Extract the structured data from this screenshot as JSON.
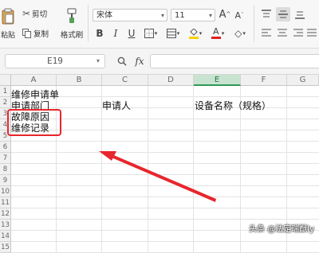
{
  "ribbon": {
    "paste_label": "粘贴",
    "cut_label": "剪切",
    "copy_label": "复制",
    "format_painter_label": "格式刷",
    "font_name": "宋体",
    "font_size": "11",
    "font_grow": "A",
    "font_shrink": "A",
    "bold": "B",
    "italic": "I",
    "underline": "U",
    "font_color_letter": "A",
    "fill_color": "#f5d000",
    "font_color": "#e02020"
  },
  "formula_bar": {
    "cell_ref": "E19",
    "fx_label": "fx",
    "content": ""
  },
  "sheet": {
    "columns": [
      "A",
      "B",
      "C",
      "D",
      "E",
      "F",
      "G"
    ],
    "selected_column": "E",
    "rows": [
      "1",
      "2",
      "3",
      "4",
      "5",
      "6",
      "7",
      "8",
      "9",
      "10",
      "11",
      "12",
      "13",
      "14",
      "15"
    ],
    "cells": {
      "A1": "维修申请单",
      "A2": "申请部门",
      "C2": "申请人",
      "E2": "设备名称（规格）",
      "A3": "故障原因",
      "A4": "维修记录"
    }
  },
  "annotation": {
    "color": "#e8262d"
  },
  "watermark": "头条 @法定瑞猷ly"
}
